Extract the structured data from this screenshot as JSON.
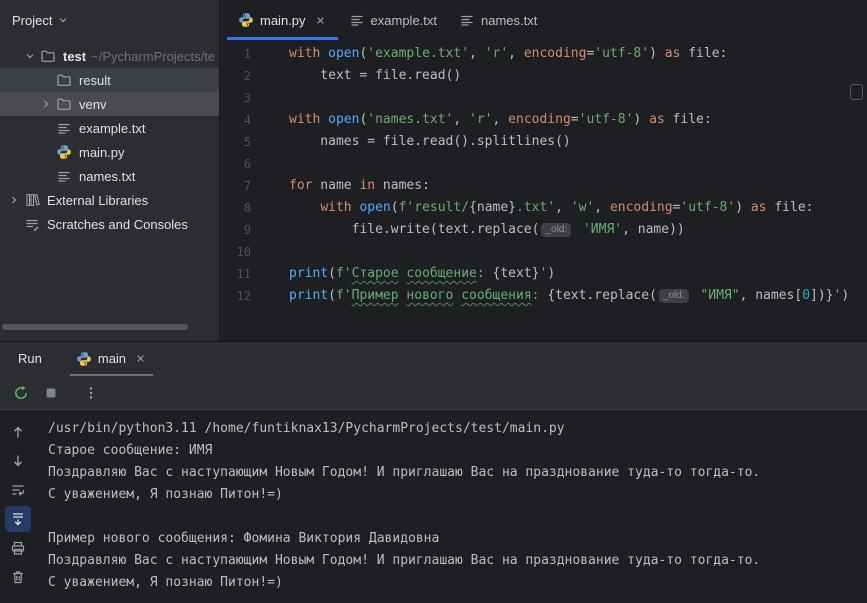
{
  "colors": {
    "accent": "#3574f0",
    "string_green": "#6aab73",
    "keyword_orange": "#cf8e6d",
    "function_blue": "#57aaf7"
  },
  "project_panel": {
    "title": "Project",
    "items": [
      {
        "label": "test",
        "suffix": "~/PycharmProjects/te",
        "icon": "folder",
        "chevron": "down",
        "bold": true,
        "indent": 1
      },
      {
        "label": "result",
        "icon": "folder",
        "chevron": "none",
        "indent": 2,
        "highlight": "selected"
      },
      {
        "label": "venv",
        "icon": "folder",
        "chevron": "right",
        "indent": 2,
        "highlight": "hover"
      },
      {
        "label": "example.txt",
        "icon": "text-file",
        "chevron": "none",
        "indent": 2
      },
      {
        "label": "main.py",
        "icon": "python",
        "chevron": "none",
        "indent": 2
      },
      {
        "label": "names.txt",
        "icon": "text-file",
        "chevron": "none",
        "indent": 2
      },
      {
        "label": "External Libraries",
        "icon": "library",
        "chevron": "right",
        "indent": 0
      },
      {
        "label": "Scratches and Consoles",
        "icon": "scratch",
        "chevron": "none",
        "indent": 0
      }
    ]
  },
  "editor": {
    "tabs": [
      {
        "label": "main.py",
        "icon": "python",
        "active": true,
        "closable": true
      },
      {
        "label": "example.txt",
        "icon": "text-file",
        "active": false,
        "closable": false
      },
      {
        "label": "names.txt",
        "icon": "text-file",
        "active": false,
        "closable": false
      }
    ],
    "lines": [
      {
        "num": "1",
        "tokens": [
          [
            "k",
            "with"
          ],
          [
            "d",
            " "
          ],
          [
            "f",
            "open"
          ],
          [
            "d",
            "("
          ],
          [
            "s",
            "'example.txt'"
          ],
          [
            "d",
            ", "
          ],
          [
            "s",
            "'r'"
          ],
          [
            "d",
            ", "
          ],
          [
            "p",
            "encoding"
          ],
          [
            "d",
            "="
          ],
          [
            "s",
            "'utf-8'"
          ],
          [
            "d",
            ") "
          ],
          [
            "k",
            "as"
          ],
          [
            "d",
            " file:"
          ]
        ]
      },
      {
        "num": "2",
        "tokens": [
          [
            "d",
            "    text = file.read()"
          ]
        ]
      },
      {
        "num": "3",
        "tokens": []
      },
      {
        "num": "4",
        "tokens": [
          [
            "k",
            "with"
          ],
          [
            "d",
            " "
          ],
          [
            "f",
            "open"
          ],
          [
            "d",
            "("
          ],
          [
            "s",
            "'names.txt'"
          ],
          [
            "d",
            ", "
          ],
          [
            "s",
            "'r'"
          ],
          [
            "d",
            ", "
          ],
          [
            "p",
            "encoding"
          ],
          [
            "d",
            "="
          ],
          [
            "s",
            "'utf-8'"
          ],
          [
            "d",
            ") "
          ],
          [
            "k",
            "as"
          ],
          [
            "d",
            " file:"
          ]
        ]
      },
      {
        "num": "5",
        "tokens": [
          [
            "d",
            "    names = file.read().splitlines()"
          ]
        ]
      },
      {
        "num": "6",
        "tokens": []
      },
      {
        "num": "7",
        "tokens": [
          [
            "k",
            "for"
          ],
          [
            "d",
            " name "
          ],
          [
            "k",
            "in"
          ],
          [
            "d",
            " names:"
          ]
        ]
      },
      {
        "num": "8",
        "tokens": [
          [
            "d",
            "    "
          ],
          [
            "k",
            "with"
          ],
          [
            "d",
            " "
          ],
          [
            "f",
            "open"
          ],
          [
            "d",
            "("
          ],
          [
            "s",
            "f'result/"
          ],
          [
            "d",
            "{name}"
          ],
          [
            "s",
            ".txt'"
          ],
          [
            "d",
            ", "
          ],
          [
            "s",
            "'w'"
          ],
          [
            "d",
            ", "
          ],
          [
            "p",
            "encoding"
          ],
          [
            "d",
            "="
          ],
          [
            "s",
            "'utf-8'"
          ],
          [
            "d",
            ") "
          ],
          [
            "k",
            "as"
          ],
          [
            "d",
            " file:"
          ]
        ]
      },
      {
        "num": "9",
        "tokens": [
          [
            "d",
            "        file.write(text.replace("
          ],
          [
            "h",
            "_old:"
          ],
          [
            "s",
            " 'ИМЯ'"
          ],
          [
            "d",
            ", name))"
          ]
        ]
      },
      {
        "num": "10",
        "tokens": []
      },
      {
        "num": "11",
        "tokens": [
          [
            "f",
            "print"
          ],
          [
            "d",
            "("
          ],
          [
            "s",
            "f'"
          ],
          [
            "t",
            "Старое"
          ],
          [
            "s",
            " "
          ],
          [
            "t",
            "сообщение"
          ],
          [
            "s",
            ": "
          ],
          [
            "d",
            "{text}"
          ],
          [
            "s",
            "'"
          ],
          [
            "d",
            ")"
          ]
        ]
      },
      {
        "num": "12",
        "tokens": [
          [
            "f",
            "print"
          ],
          [
            "d",
            "("
          ],
          [
            "s",
            "f'"
          ],
          [
            "t",
            "Пример"
          ],
          [
            "s",
            " "
          ],
          [
            "t",
            "нового"
          ],
          [
            "s",
            " "
          ],
          [
            "t",
            "сообщения"
          ],
          [
            "s",
            ": "
          ],
          [
            "d",
            "{text.replace("
          ],
          [
            "h",
            "_old:"
          ],
          [
            "s",
            " \"ИМЯ\""
          ],
          [
            "d",
            ", names["
          ],
          [
            "n",
            "0"
          ],
          [
            "d",
            "])}"
          ],
          [
            "s",
            "'"
          ],
          [
            "d",
            ")"
          ]
        ]
      }
    ]
  },
  "run_panel": {
    "title": "Run",
    "tab": {
      "label": "main",
      "icon": "python",
      "closable": true
    },
    "toolbar": [
      {
        "name": "rerun"
      },
      {
        "name": "stop"
      },
      {
        "name": "more"
      }
    ],
    "rail": [
      {
        "name": "arrow-up"
      },
      {
        "name": "arrow-down"
      },
      {
        "name": "soft-wrap"
      },
      {
        "name": "scroll-to-end",
        "selected": true
      },
      {
        "name": "print"
      },
      {
        "name": "clear"
      }
    ],
    "console": [
      "/usr/bin/python3.11 /home/funtiknax13/PycharmProjects/test/main.py",
      "Старое сообщение: ИМЯ",
      "Поздравляю Вас с наступающим Новым Годом! И приглашаю Вас на празднование туда-то тогда-то.",
      "С уважением, Я познаю Питон!=)",
      "",
      "Пример нового сообщения: Фомина Виктория Давидовна",
      "Поздравляю Вас с наступающим Новым Годом! И приглашаю Вас на празднование туда-то тогда-то.",
      "С уважением, Я познаю Питон!=)"
    ]
  }
}
